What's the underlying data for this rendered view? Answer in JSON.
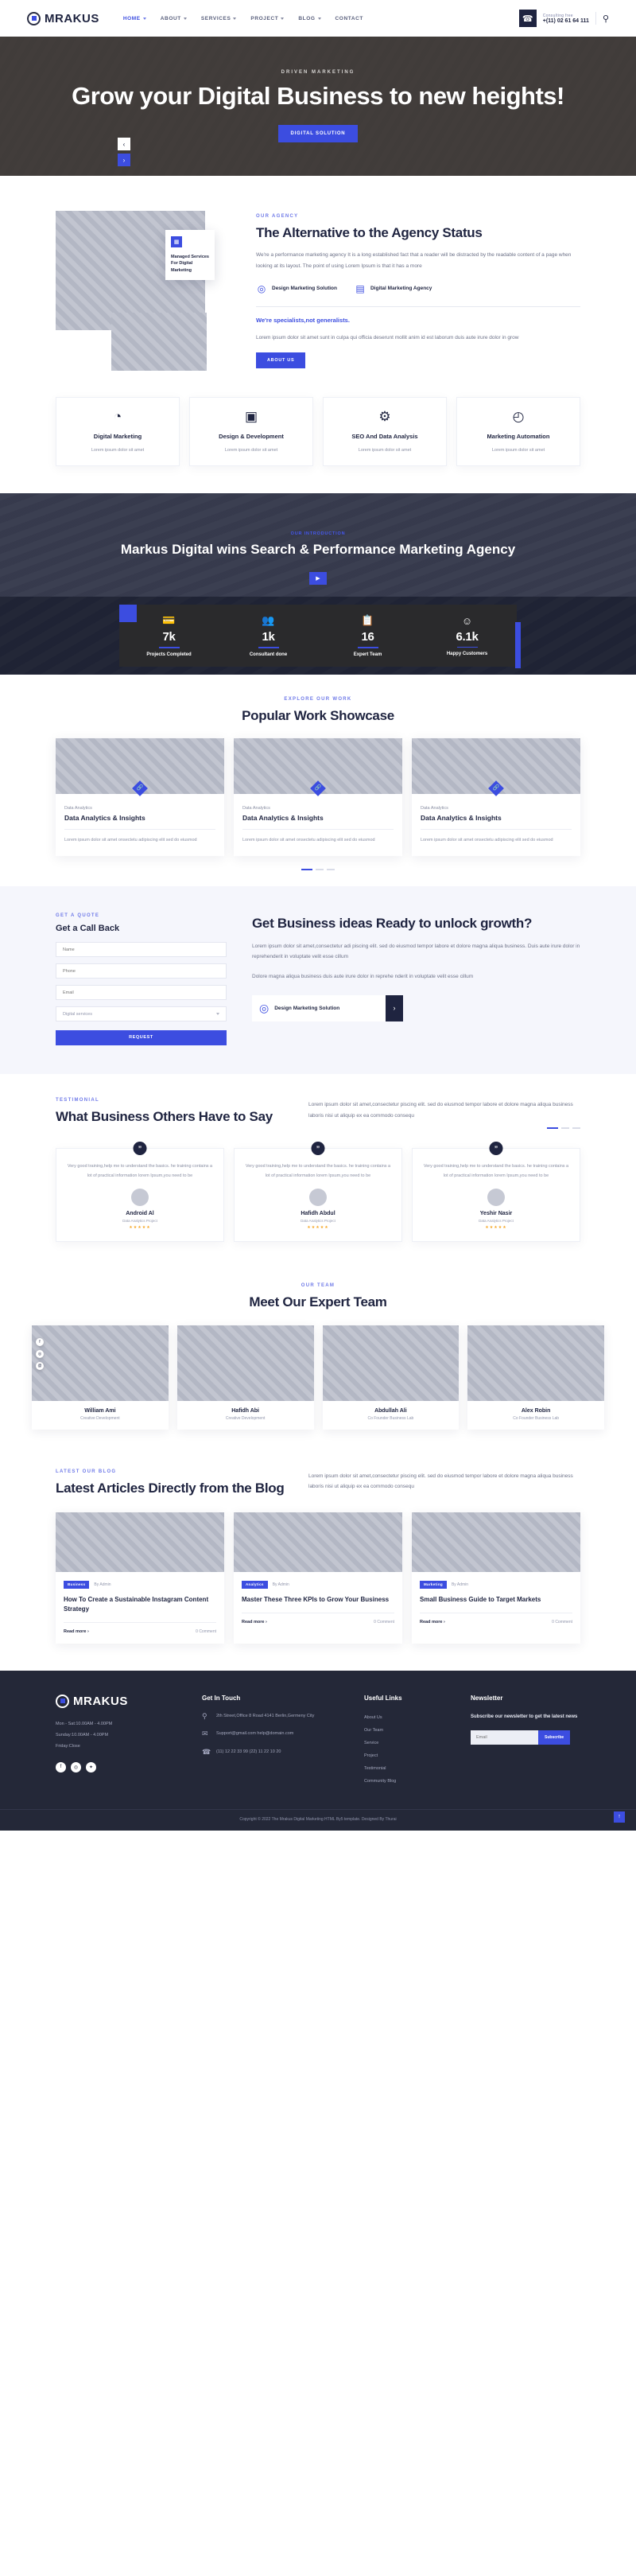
{
  "brand": {
    "name": "MRAKUS"
  },
  "header": {
    "nav": [
      {
        "label": "HOME",
        "active": true,
        "caret": true
      },
      {
        "label": "ABOUT",
        "active": false,
        "caret": true
      },
      {
        "label": "SERVICES",
        "active": false,
        "caret": true
      },
      {
        "label": "PROJECT",
        "active": false,
        "caret": true
      },
      {
        "label": "BLOG",
        "active": false,
        "caret": true
      },
      {
        "label": "CONTACT",
        "active": false,
        "caret": false
      }
    ],
    "phone_icon": "phone-icon",
    "consulting_label": "Consulting free",
    "phone_number": "+(11) 02 61 64 111",
    "search_icon": "search-icon"
  },
  "hero": {
    "eyebrow": "DRIVEN MARKETING",
    "title": "Grow your Digital Business to new heights!",
    "cta": "DIGITAL SOLUTION",
    "prev": "‹",
    "next": "›"
  },
  "about": {
    "badge": {
      "icon": "monitor-icon",
      "text": "Managed Services For Digital Marketing"
    },
    "eyebrow": "OUR AGENCY",
    "title": "The Alternative to the Agency Status",
    "paragraph": "We're a performance marketing agency It is a long established fact that a reader will be distracted by the readable content of a page when looking at its layout. The point of using Lorem Ipsum is that it has a more",
    "features": [
      {
        "icon": "target-icon",
        "label": "Design Marketing Solution"
      },
      {
        "icon": "layout-icon",
        "label": "Digital Marketing Agency"
      }
    ],
    "highlight": "We're specialists,not generalists.",
    "sub_paragraph": "Lorem ipsum dolor sit amet sunt in culpa qui officia deserunt mollit anim id est laborum duis aute irure dolor in grow",
    "cta": "ABOUT US"
  },
  "services": [
    {
      "icon": "pie-chart-icon",
      "title": "Digital Marketing",
      "desc": "Lorem ipsum dolor sit amet"
    },
    {
      "icon": "monitor-design-icon",
      "title": "Design & Development",
      "desc": "Lorem ipsum dolor sit amet"
    },
    {
      "icon": "gear-icon",
      "title": "SEO And Data Analysis",
      "desc": "Lorem ipsum dolor sit amet"
    },
    {
      "icon": "clock-screen-icon",
      "title": "Marketing Automation",
      "desc": "Lorem ipsum dolor sit amet"
    }
  ],
  "banner": {
    "eyebrow": "OUR INTRODUCTION",
    "title": "Markus Digital wins Search & Performance Marketing Agency",
    "play_icon": "play-icon"
  },
  "stats": [
    {
      "icon": "card-check-icon",
      "number": "7k",
      "label": "Projects Completed"
    },
    {
      "icon": "people-icon",
      "number": "1k",
      "label": "Consultant done"
    },
    {
      "icon": "cards-icon",
      "number": "16",
      "label": "Expert Team"
    },
    {
      "icon": "smile-icon",
      "number": "6.1k",
      "label": "Happy Customers"
    }
  ],
  "work": {
    "eyebrow": "EXPLORE OUR WORK",
    "title": "Popular Work Showcase",
    "cards": [
      {
        "icon": "link-icon",
        "category": "Data Analytics",
        "title": "Data Analytics & Insights",
        "desc": "Lorem ipsum dolor sit amet onsectetu adipiscing elit sed do eiusmod"
      },
      {
        "icon": "link-icon",
        "category": "Data Analytics",
        "title": "Data Analytics & Insights",
        "desc": "Lorem ipsum dolor sit amet onsectetu adipiscing elit sed do eiusmod"
      },
      {
        "icon": "link-icon",
        "category": "Data Analytics",
        "title": "Data Analytics & Insights",
        "desc": "Lorem ipsum dolor sit amet onsectetu adipiscing elit sed do eiusmod"
      }
    ]
  },
  "quote": {
    "eyebrow": "GET A QUOTE",
    "form_title": "Get a Call Back",
    "fields": [
      {
        "name": "name-field",
        "placeholder": "Name"
      },
      {
        "name": "phone-field",
        "placeholder": "Phone"
      },
      {
        "name": "email-field",
        "placeholder": "Email"
      }
    ],
    "select_value": "Digital services",
    "submit": "REQUEST",
    "title": "Get Business ideas Ready to unlock growth?",
    "paragraph1": "Lorem ipsum dolor sit amet,consectetur adi piscing elit. sed do eiusmod tempor labore et dolore magna aliqua business. Duis aute irure dolor in reprehenderit in voluptate velit esse cillum",
    "paragraph2": "Dolore magna aliqua business duis aute irure dolor in reprehe nderit in voluptate velit esse cillum",
    "card_icon": "target-icon",
    "card_title": "Design Marketing Solution",
    "card_arrow": "›"
  },
  "testimonial": {
    "eyebrow": "TESTIMONIAL",
    "title": "What Business Others Have to Say",
    "paragraph": "Lorem ipsum dolor sit amet,consectetur piscing elit. sed do eiusmod tempor labore et dolore magna aliqua business laboris nisi ut aliquip ex ea commodo consequ",
    "cards": [
      {
        "quote_icon": "quote-icon",
        "text": "Very good training,help me to understand the basics. he training contains a lot of practical information lorem Ipsum,you need to be",
        "name": "Android Al",
        "role": "Data Analytics Project",
        "stars": "★★★★★"
      },
      {
        "quote_icon": "quote-icon",
        "text": "Very good training,help me to understand the basics. he training contains a lot of practical information lorem Ipsum,you need to be",
        "name": "Hafidh Abdul",
        "role": "Data Analytics Project",
        "stars": "★★★★★"
      },
      {
        "quote_icon": "quote-icon",
        "text": "Very good training,help me to understand the basics. he training contains a lot of practical information lorem Ipsum,you need to be",
        "name": "Yeshir Nasir",
        "role": "Data Analytics Project",
        "stars": "★★★★★"
      }
    ]
  },
  "team": {
    "eyebrow": "OUR TEAM",
    "title": "Meet Our Expert Team",
    "socials": [
      "f",
      "◎",
      "@"
    ],
    "members": [
      {
        "name": "William Ami",
        "role": "Creative Development"
      },
      {
        "name": "Hafidh Abi",
        "role": "Creative Development"
      },
      {
        "name": "Abdullah Ali",
        "role": "Co Founder Business Lab"
      },
      {
        "name": "Alex Robin",
        "role": "Co Founder Business Lab"
      }
    ]
  },
  "blog": {
    "eyebrow": "LATEST OUR BLOG",
    "title": "Latest Articles Directly from the Blog",
    "paragraph": "Lorem ipsum dolor sit amet,consectetur piscing elit. sed do eiusmod tempor labore et dolore magna aliqua business laboris nisi ut aliquip ex ea commodo consequ",
    "cards": [
      {
        "tag": "Business",
        "by": "By Admin",
        "title": "How To Create a Sustainable Instagram Content Strategy",
        "more": "Read more  ›",
        "comments": "0 Comment"
      },
      {
        "tag": "Analytics",
        "by": "By Admin",
        "title": "Master These Three KPIs to Grow Your Business",
        "more": "Read more  ›",
        "comments": "0 Comment"
      },
      {
        "tag": "Marketing",
        "by": "By Admin",
        "title": "Small Business Guide to Target Markets",
        "more": "Read more  ›",
        "comments": "0 Comment"
      }
    ]
  },
  "footer": {
    "hours": [
      "Mon - Sat:10.00AM - 4.00PM",
      "Sunday:10.00AM - 4.00PM",
      "Friday:Close"
    ],
    "socials": [
      "f",
      "◎",
      "✉"
    ],
    "touch_title": "Get In Touch",
    "contacts": [
      {
        "icon": "location-icon",
        "lines": "2th Street,Office 8 Road 4141 Berlin,Germeny City"
      },
      {
        "icon": "mail-icon",
        "lines": "Support@gmail.com help@domain.com"
      },
      {
        "icon": "phone-icon",
        "lines": "(11) 12 22 33 99 (22) 11 22 10 20"
      }
    ],
    "links_title": "Useful Links",
    "links": [
      "About Us",
      "Our Team",
      "Service",
      "Project",
      "Testimonial",
      "Community Blog"
    ],
    "news_title": "Newsletter",
    "news_text": "Subscribe our newsletter to get the latest news",
    "news_placeholder": "Email",
    "news_button": "Subscribe",
    "copyright": "Copyright © 2022 The Mrakus Digital Marketing HTML By5 template. Designed By Thurai",
    "to_top": "↑"
  }
}
